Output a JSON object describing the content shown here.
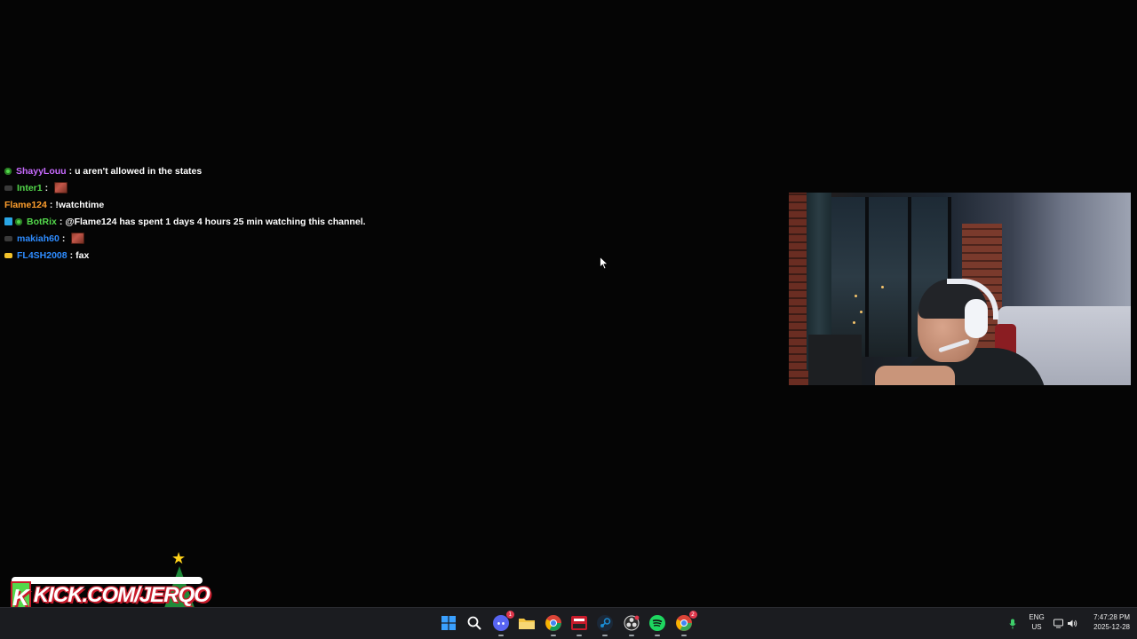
{
  "chat": {
    "messages": [
      {
        "badges": [
          "green"
        ],
        "username": "ShayyLouu",
        "color": "#c86bff",
        "text": "u aren't allowed in the states",
        "emote": false
      },
      {
        "badges": [
          "gray"
        ],
        "username": "Inter1",
        "color": "#53d84b",
        "text": "",
        "emote": true
      },
      {
        "badges": [],
        "username": "Flame124",
        "color": "#ff9f2e",
        "text": "!watchtime",
        "emote": false
      },
      {
        "badges": [
          "blue-sq",
          "green"
        ],
        "username": "BotRix",
        "color": "#53d84b",
        "text": "@Flame124 has spent 1 days 4 hours 25 min watching this channel.",
        "emote": false
      },
      {
        "badges": [
          "gray"
        ],
        "username": "makiah60",
        "color": "#2e8cff",
        "text": "",
        "emote": true
      },
      {
        "badges": [
          "yellow"
        ],
        "username": "FL4SH2008",
        "color": "#2e8cff",
        "text": "fax",
        "emote": false
      }
    ],
    "separator": ":"
  },
  "brand": {
    "logo_letter": "K",
    "text": "KICK.COM/JERQO",
    "accent": "#53d84b",
    "outline": "#c81b2b"
  },
  "taskbar": {
    "icons": [
      {
        "name": "windows-start-icon",
        "color": "#3aa0ff"
      },
      {
        "name": "search-icon",
        "color": "#ffffff"
      },
      {
        "name": "discord-icon",
        "color": "#5865f2",
        "badge": "1"
      },
      {
        "name": "file-explorer-icon",
        "color": "#f4c542"
      },
      {
        "name": "chrome-icon",
        "color": "#4285f4"
      },
      {
        "name": "media-app-icon",
        "color": "#c81b2b"
      },
      {
        "name": "steam-icon",
        "color": "#1b8bd1"
      },
      {
        "name": "obs-icon",
        "color": "#e0364b"
      },
      {
        "name": "spotify-icon",
        "color": "#1ed760"
      },
      {
        "name": "chrome-profile-icon",
        "color": "#34a853",
        "badge": "2"
      }
    ],
    "tray": {
      "lang_top": "ENG",
      "lang_bottom": "US",
      "time": "7:47:28 PM",
      "date": "2025-12-28"
    }
  }
}
